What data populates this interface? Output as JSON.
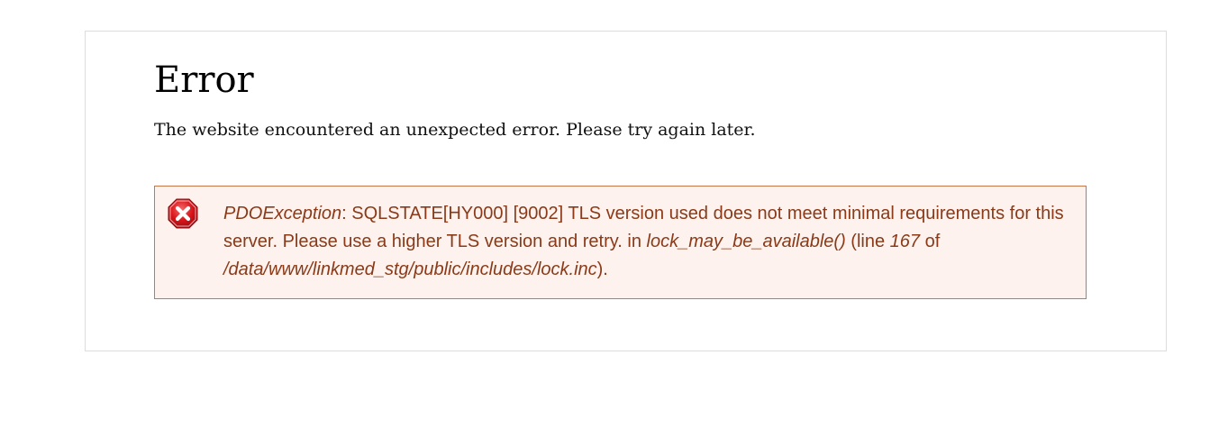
{
  "page": {
    "title": "Error",
    "lead": "The website encountered an unexpected error. Please try again later."
  },
  "error": {
    "icon": "error-x-icon",
    "exception_type": "PDOException",
    "message_text": ": SQLSTATE[HY000] [9002] TLS version used does not meet minimal requirements for this server. Please use a higher TLS version and retry. in ",
    "function": "lock_may_be_available()",
    "line_label": " (line ",
    "line_number": "167",
    "of_label": " of ",
    "file_path": "/data/www/linkmed_stg/public/includes/lock.inc",
    "terminator": ")."
  },
  "colors": {
    "error_border": "#c8774b",
    "error_background": "#fdf2ed",
    "error_text": "#8a3a18",
    "icon_red": "#d7141a"
  }
}
